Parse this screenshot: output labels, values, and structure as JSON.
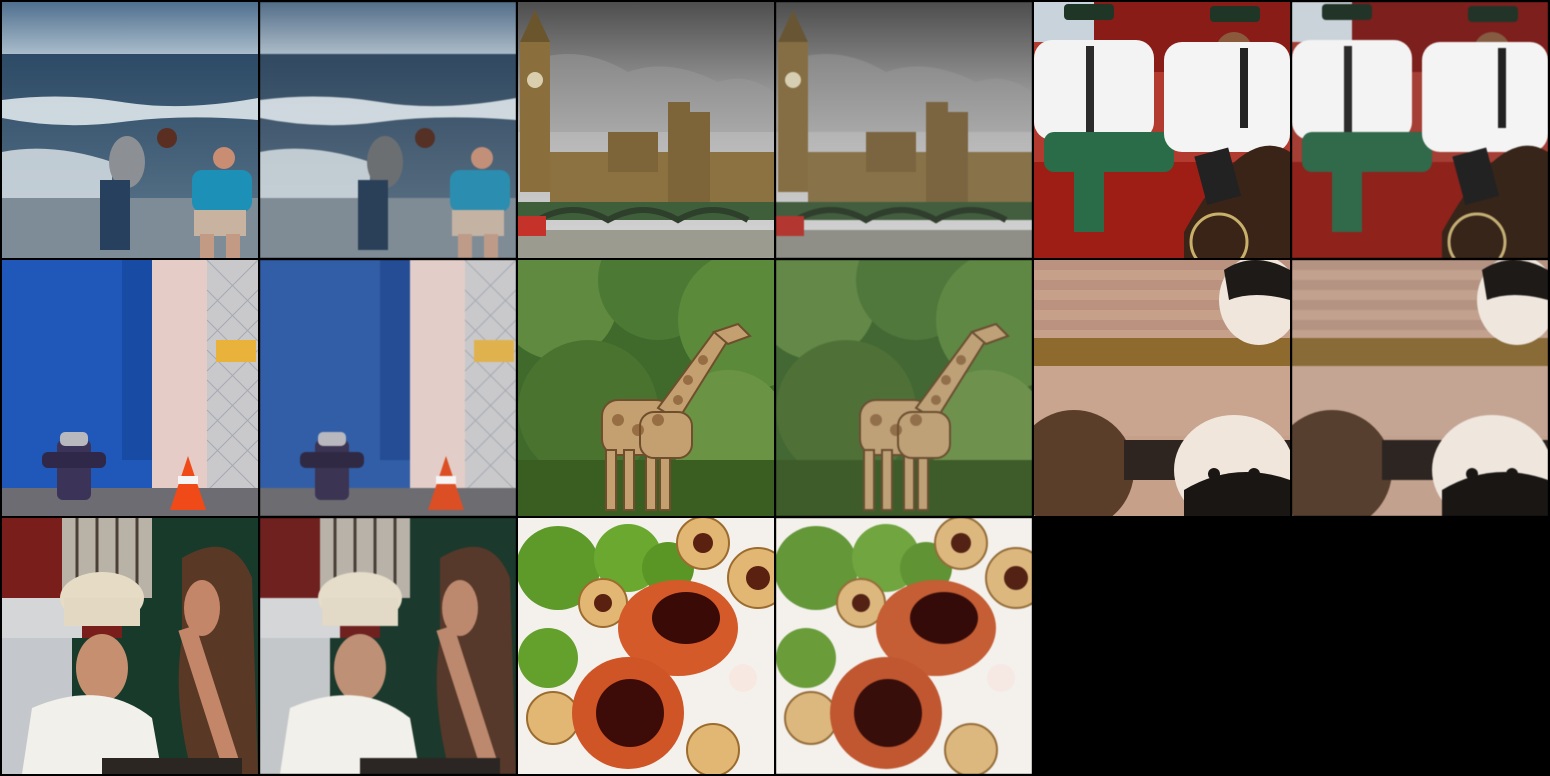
{
  "grid": {
    "rows": 3,
    "cols": 6,
    "background": "#000000",
    "tiles": [
      {
        "scene": "beach",
        "variant": "original"
      },
      {
        "scene": "beach",
        "variant": "reconstruction"
      },
      {
        "scene": "parliament",
        "variant": "original"
      },
      {
        "scene": "parliament",
        "variant": "reconstruction"
      },
      {
        "scene": "carriage-drivers",
        "variant": "original"
      },
      {
        "scene": "carriage-drivers",
        "variant": "reconstruction"
      },
      {
        "scene": "hydrant",
        "variant": "original"
      },
      {
        "scene": "hydrant",
        "variant": "reconstruction"
      },
      {
        "scene": "giraffes",
        "variant": "original"
      },
      {
        "scene": "giraffes",
        "variant": "reconstruction"
      },
      {
        "scene": "cats",
        "variant": "original"
      },
      {
        "scene": "cats",
        "variant": "reconstruction"
      },
      {
        "scene": "dinner",
        "variant": "original"
      },
      {
        "scene": "dinner",
        "variant": "reconstruction"
      },
      {
        "scene": "food",
        "variant": "original"
      },
      {
        "scene": "food",
        "variant": "reconstruction"
      },
      {
        "scene": "empty",
        "variant": "none"
      },
      {
        "scene": "empty",
        "variant": "none"
      }
    ]
  }
}
